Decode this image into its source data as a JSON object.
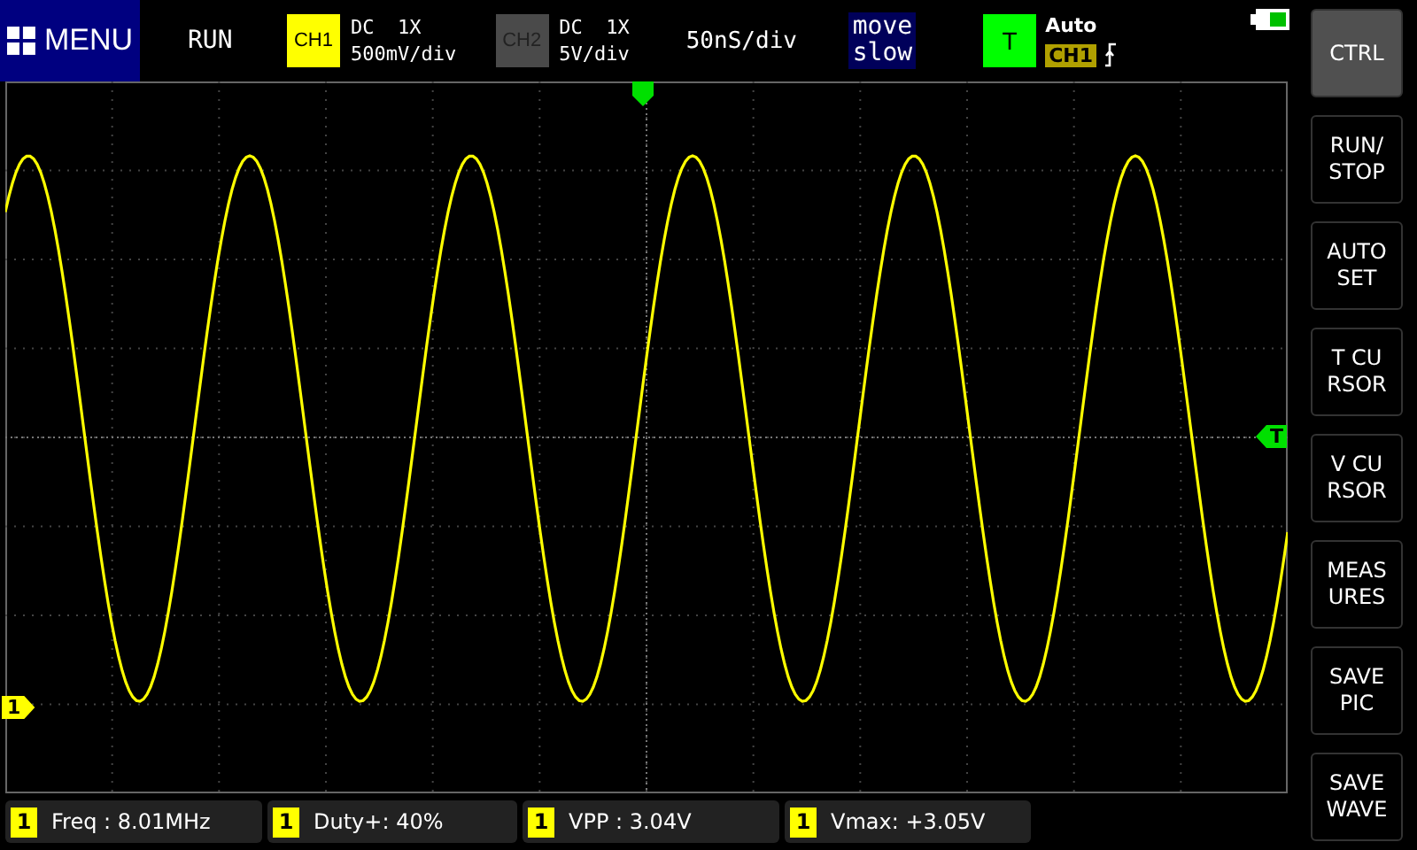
{
  "menu_button": {
    "label": "MENU"
  },
  "run_state": "RUN",
  "channels": [
    {
      "label": "CH1",
      "coupling": "DC  1X",
      "scale": "500mV/div",
      "enabled": true
    },
    {
      "label": "CH2",
      "coupling": "DC  1X",
      "scale": "5V/div",
      "enabled": false
    }
  ],
  "timebase": "50nS/div",
  "move_mode": {
    "line_1": "move",
    "line_2": "slow"
  },
  "trigger": {
    "label": "T",
    "mode": "Auto",
    "source": "CH1"
  },
  "markers": {
    "trigger_level": "T",
    "channel_1": "1"
  },
  "side_buttons": [
    {
      "label": "CTRL",
      "selected": true
    },
    {
      "label": "RUN/\nSTOP",
      "selected": false
    },
    {
      "label": "AUTO\nSET",
      "selected": false
    },
    {
      "label": "T  CU\nRSOR",
      "selected": false
    },
    {
      "label": "V  CU\nRSOR",
      "selected": false
    },
    {
      "label": "MEAS\nURES",
      "selected": false
    },
    {
      "label": "SAVE\nPIC",
      "selected": false
    },
    {
      "label": "SAVE\nWAVE",
      "selected": false
    }
  ],
  "measurements": [
    {
      "channel": "1",
      "text": "Freq : 8.01MHz"
    },
    {
      "channel": "1",
      "text": "Duty+: 40%"
    },
    {
      "channel": "1",
      "text": "VPP : 3.04V"
    },
    {
      "channel": "1",
      "text": "Vmax: +3.05V"
    }
  ]
}
